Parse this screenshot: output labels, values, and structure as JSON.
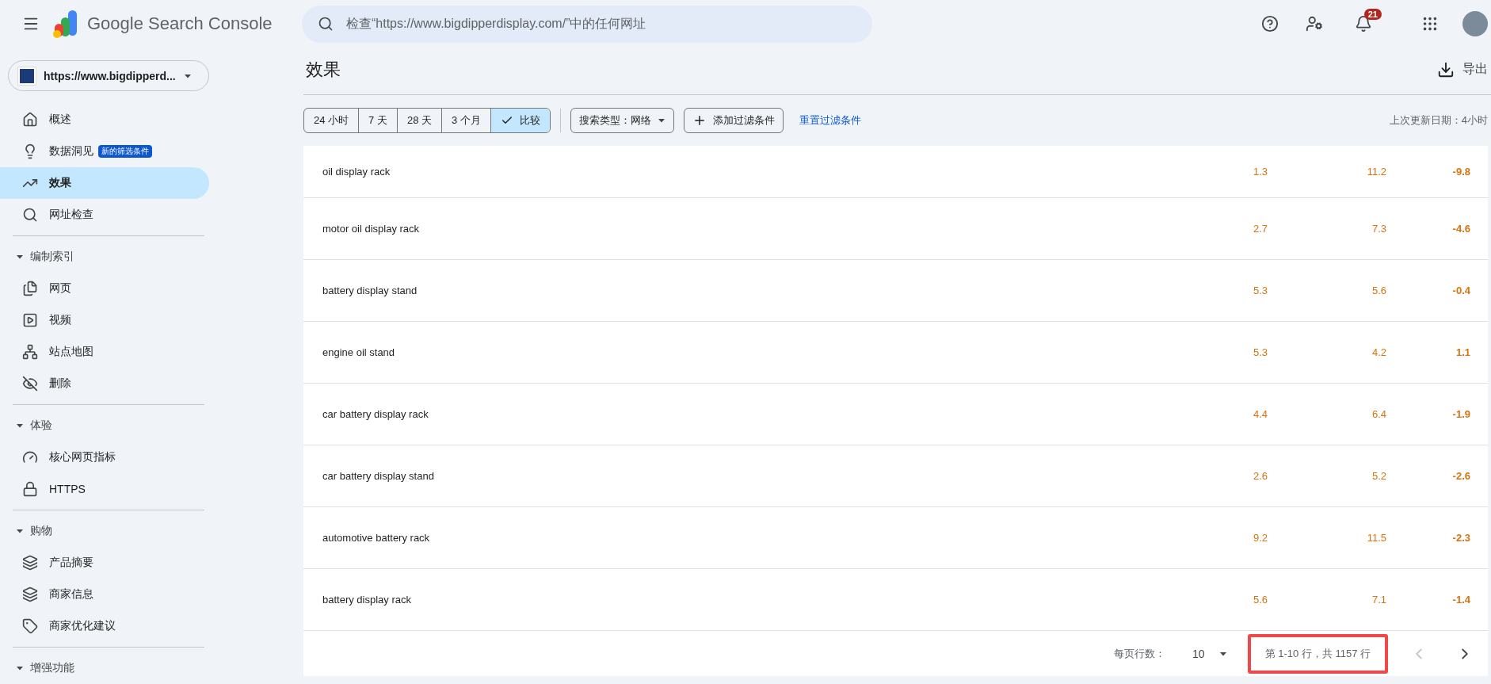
{
  "header": {
    "product_name": "Google Search Console",
    "search": {
      "placeholder": "检查“https://www.bigdipperdisplay.com/”中的任何网址"
    },
    "notifications": {
      "count": "21"
    }
  },
  "property": {
    "label": "https://www.bigdipperd..."
  },
  "sidebar": {
    "top_items": [
      {
        "label": "概述",
        "selected": false
      },
      {
        "label": "数据洞见",
        "selected": false,
        "badge": "新的筛选条件"
      },
      {
        "label": "效果",
        "selected": true
      },
      {
        "label": "网址检查",
        "selected": false
      }
    ],
    "sections": [
      {
        "title": "编制索引",
        "expanded": true,
        "items": [
          {
            "label": "网页",
            "selected": false
          },
          {
            "label": "视频",
            "selected": false
          },
          {
            "label": "站点地图",
            "selected": false
          },
          {
            "label": "删除",
            "selected": false
          }
        ]
      },
      {
        "title": "体验",
        "expanded": true,
        "items": [
          {
            "label": "核心网页指标",
            "selected": false
          },
          {
            "label": "HTTPS",
            "selected": false
          }
        ]
      },
      {
        "title": "购物",
        "expanded": true,
        "items": [
          {
            "label": "产品摘要",
            "selected": false
          },
          {
            "label": "商家信息",
            "selected": false
          },
          {
            "label": "商家优化建议",
            "selected": false
          }
        ]
      },
      {
        "title": "增强功能",
        "expanded": true
      }
    ]
  },
  "page": {
    "title": "效果",
    "export": "导出"
  },
  "date_ranges": [
    {
      "label": "24 小时",
      "selected": false
    },
    {
      "label": "7 天",
      "selected": false
    },
    {
      "label": "28 天",
      "selected": false
    },
    {
      "label": "3 个月",
      "selected": false
    },
    {
      "label": "比较",
      "selected": true
    }
  ],
  "filters": {
    "search_type": "搜索类型：网络",
    "add_filter": "添加过滤条件",
    "reset": "重置过滤条件",
    "last_updated": "上次更新日期：4小时"
  },
  "table": {
    "rows": [
      {
        "query": "oil display rack",
        "column_2": "1.3",
        "column_3": "11.2",
        "column_4": "-9.8"
      },
      {
        "query": "motor oil display rack",
        "column_2": "2.7",
        "column_3": "7.3",
        "column_4": "-4.6"
      },
      {
        "query": "battery display stand",
        "column_2": "5.3",
        "column_3": "5.6",
        "column_4": "-0.4"
      },
      {
        "query": "engine oil stand",
        "column_2": "5.3",
        "column_3": "4.2",
        "column_4": "1.1"
      },
      {
        "query": "car battery display rack",
        "column_2": "4.4",
        "column_3": "6.4",
        "column_4": "-1.9"
      },
      {
        "query": "car battery display stand",
        "column_2": "2.6",
        "column_3": "5.2",
        "column_4": "-2.6"
      },
      {
        "query": "automotive battery rack",
        "column_2": "9.2",
        "column_3": "11.5",
        "column_4": "-2.3"
      },
      {
        "query": "battery display rack",
        "column_2": "5.6",
        "column_3": "7.1",
        "column_4": "-1.4"
      }
    ]
  },
  "pagination": {
    "rows_per_page_label": "每页行数：",
    "rows_per_page": "10",
    "range": "第 1-10 行，共 1157 行",
    "prev_disabled": true,
    "next_disabled": false
  }
}
